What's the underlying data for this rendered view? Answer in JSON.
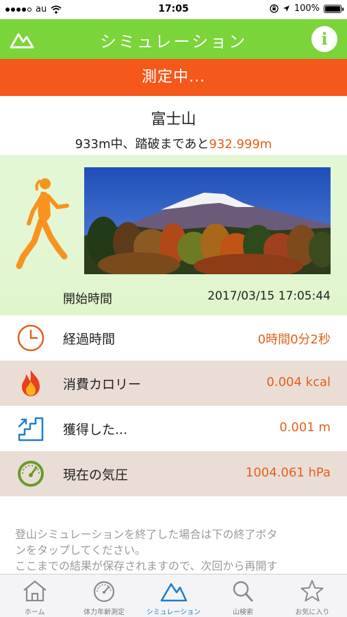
{
  "status_bar": {
    "carrier": "au",
    "time": "17:05",
    "battery": "100%"
  },
  "nav": {
    "title": "シミュレーション",
    "info_label": "i",
    "left_icon": "mountain-icon"
  },
  "banner": {
    "text": "測定中..."
  },
  "mountain": {
    "name": "富士山",
    "progress_prefix": "933m中、踏破まであと",
    "remaining": "932.999m"
  },
  "start": {
    "label": "開始時間",
    "value": "2017/03/15 17:05:44"
  },
  "stats": [
    {
      "icon": "clock-icon",
      "label": "経過時間",
      "value": "0時間0分2秒"
    },
    {
      "icon": "flame-icon",
      "label": "消費カロリー",
      "value": "0.004 kcal"
    },
    {
      "icon": "stairs-icon",
      "label": "獲得した...",
      "value": "0.001 m"
    },
    {
      "icon": "gauge-icon",
      "label": "現在の気圧",
      "value": "1004.061 hPa"
    }
  ],
  "notice": {
    "line1": "登山シミュレーションを終了した場合は下の終了ボタ",
    "line2": "ンをタップしてください。",
    "line3": "ここまでの結果が保存されますので、次回から再開す"
  },
  "tabs": [
    {
      "icon": "home-icon",
      "label": "ホーム"
    },
    {
      "icon": "speedometer-icon",
      "label": "体力年齢測定"
    },
    {
      "icon": "mountain-icon",
      "label": "シミュレーション",
      "active": true
    },
    {
      "icon": "search-icon",
      "label": "山検索"
    },
    {
      "icon": "star-icon",
      "label": "お気に入り"
    }
  ],
  "colors": {
    "nav_green": "#7bd43a",
    "banner_orange": "#f4581a",
    "value_orange": "#e2601a",
    "tab_active_blue": "#1d7dcf"
  }
}
